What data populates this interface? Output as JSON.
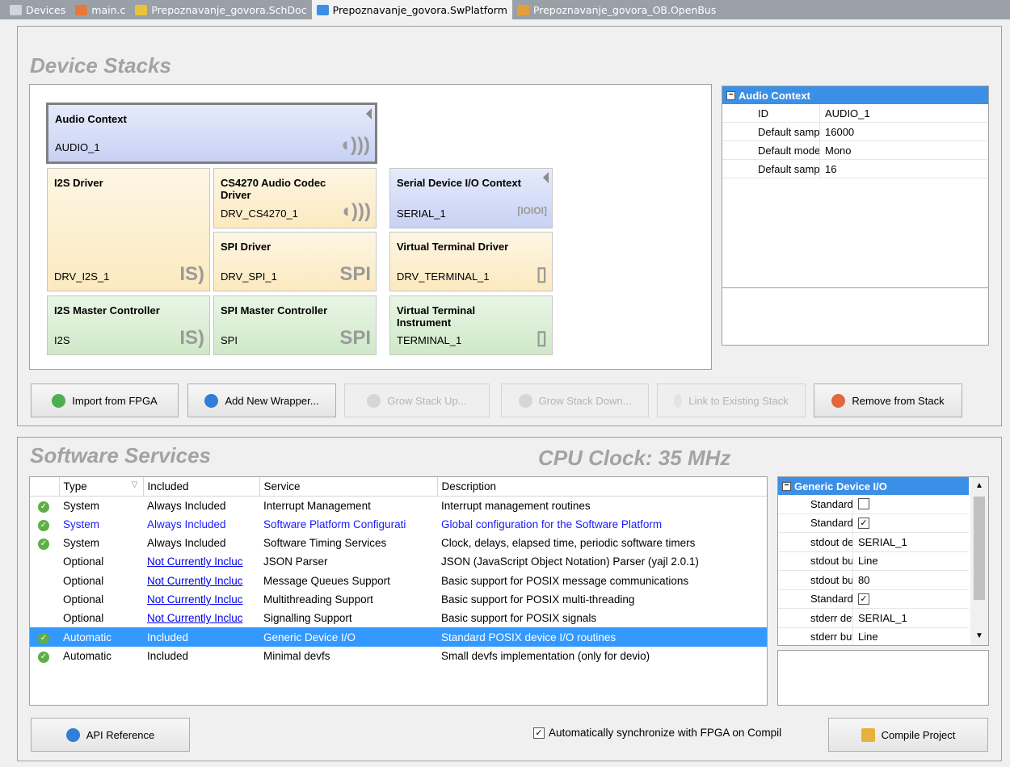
{
  "tabs": [
    {
      "label": "Devices",
      "icon": "devices-icon",
      "color": "#d0d4e0"
    },
    {
      "label": "main.c",
      "icon": "c-file-icon",
      "color": "#e8773b"
    },
    {
      "label": "Prepoznavanje_govora.SchDoc",
      "icon": "schematic-icon",
      "color": "#e8c23b"
    },
    {
      "label": "Prepoznavanje_govora.SwPlatform",
      "icon": "swplatform-icon",
      "color": "#3b8fe6",
      "active": true
    },
    {
      "label": "Prepoznavanje_govora_OB.OpenBus",
      "icon": "openbus-icon",
      "color": "#e89d3b"
    }
  ],
  "device_stacks": {
    "title": "Device Stacks",
    "cards": {
      "audio_context": {
        "title": "Audio Context",
        "value": "AUDIO_1"
      },
      "i2s_driver": {
        "title": "I2S Driver",
        "value": "DRV_I2S_1"
      },
      "cs4270": {
        "title": "CS4270 Audio Codec Driver",
        "value": "DRV_CS4270_1"
      },
      "serial_context": {
        "title": "Serial Device I/O Context",
        "value": "SERIAL_1"
      },
      "spi_driver": {
        "title": "SPI Driver",
        "value": "DRV_SPI_1",
        "glyph": "SPI"
      },
      "vterm_driver": {
        "title": "Virtual Terminal Driver",
        "value": "DRV_TERMINAL_1"
      },
      "i2s_master": {
        "title": "I2S Master Controller",
        "value": "I2S"
      },
      "spi_master": {
        "title": "SPI Master Controller",
        "value": "SPI",
        "glyph": "SPI"
      },
      "vterm_instr": {
        "title": "Virtual Terminal Instrument",
        "value": "TERMINAL_1"
      }
    },
    "properties": {
      "header": "Audio Context",
      "rows": [
        {
          "key": "ID",
          "value": "AUDIO_1"
        },
        {
          "key": "Default sample f",
          "value": "16000"
        },
        {
          "key": "Default mode",
          "value": "Mono"
        },
        {
          "key": "Default sample s",
          "value": "16"
        }
      ]
    },
    "buttons": {
      "import": "Import from FPGA",
      "add_wrapper": "Add New Wrapper...",
      "grow_up": "Grow Stack Up...",
      "grow_down": "Grow Stack Down...",
      "link": "Link to Existing Stack",
      "remove": "Remove from Stack"
    }
  },
  "software_services": {
    "title": "Software Services",
    "cpu_clock": "CPU Clock: 35 MHz",
    "columns": [
      "Type",
      "Included",
      "Service",
      "Description"
    ],
    "rows": [
      {
        "type": "System",
        "included": "Always Included",
        "service": "Interrupt Management",
        "description": "Interrupt management routines",
        "check": true
      },
      {
        "type": "System",
        "included": "Always Included",
        "service": "Software Platform Configurati",
        "description": "Global configuration for the Software Platform",
        "check": true,
        "blue": true
      },
      {
        "type": "System",
        "included": "Always Included",
        "service": "Software Timing Services",
        "description": "Clock, delays, elapsed time, periodic software timers",
        "check": true
      },
      {
        "type": "Optional",
        "included": "Not Currently Incluc",
        "service": "JSON Parser",
        "description": "JSON (JavaScript Object Notation) Parser (yajl 2.0.1)",
        "link": true
      },
      {
        "type": "Optional",
        "included": "Not Currently Incluc",
        "service": "Message Queues Support",
        "description": "Basic support for POSIX message communications",
        "link": true
      },
      {
        "type": "Optional",
        "included": "Not Currently Incluc",
        "service": "Multithreading Support",
        "description": "Basic support for POSIX multi-threading",
        "link": true
      },
      {
        "type": "Optional",
        "included": "Not Currently Incluc",
        "service": "Signalling Support",
        "description": "Basic support for POSIX signals",
        "link": true
      },
      {
        "type": "Automatic",
        "included": "Included",
        "service": "Generic Device I/O",
        "description": "Standard POSIX device I/O routines",
        "check": true,
        "selected": true
      },
      {
        "type": "Automatic",
        "included": "Included",
        "service": "Minimal devfs",
        "description": "Small devfs implementation (only for devio)",
        "check": true
      }
    ],
    "properties": {
      "header": "Generic Device I/O",
      "rows": [
        {
          "key": "Standard Ir",
          "value": "",
          "checkbox": "unchecked"
        },
        {
          "key": "Standard O",
          "value": "",
          "checkbox": "checked"
        },
        {
          "key": "stdout devi",
          "value": "SERIAL_1"
        },
        {
          "key": "stdout buff",
          "value": "Line"
        },
        {
          "key": "stdout bufs",
          "value": "80"
        },
        {
          "key": "Standard Er",
          "value": "",
          "checkbox": "checked"
        },
        {
          "key": "stderr devic",
          "value": "SERIAL_1"
        },
        {
          "key": "stderr buffe",
          "value": "Line"
        }
      ]
    },
    "api_button": "API Reference",
    "sync_label": "Automatically synchronize with FPGA on Compil",
    "compile_button": "Compile Project"
  }
}
